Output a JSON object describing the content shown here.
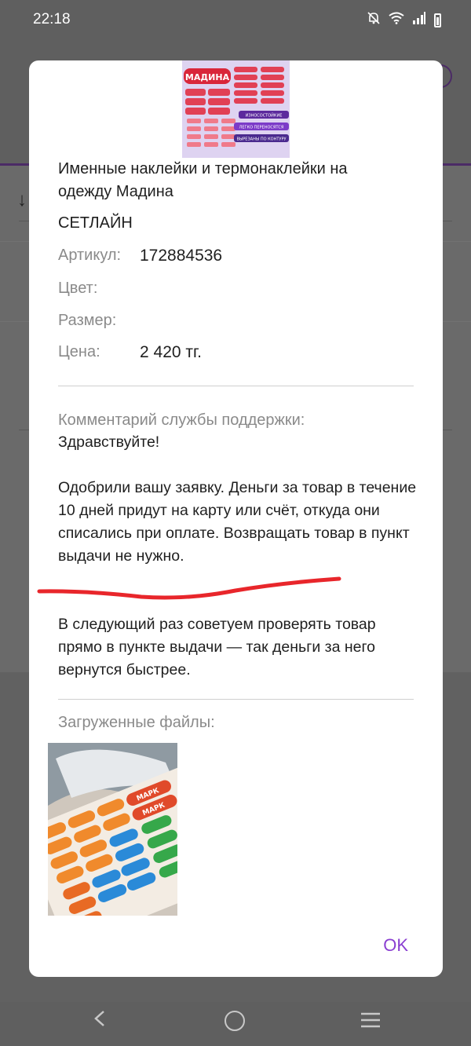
{
  "status_bar": {
    "time": "22:18"
  },
  "dialog": {
    "product": {
      "title": "Именные наклейки и термонаклейки на одежду Мадина",
      "brand": "СЕТЛАЙН",
      "article_label": "Артикул:",
      "article_value": "172884536",
      "color_label": "Цвет:",
      "color_value": "",
      "size_label": "Размер:",
      "size_value": "",
      "price_label": "Цена:",
      "price_value": "2 420 тг."
    },
    "product_image_text": {
      "banner": "МАДИНА",
      "badge1": "ИЗНОСОСТОЙКИЕ",
      "badge2": "ЛЕГКО ПЕРЕНОСЯТСЯ",
      "badge3": "ВЫРЕЗАНЫ ПО КОНТУРУ"
    },
    "support": {
      "label": "Комментарий службы поддержки:",
      "greeting": "Здравствуйте!",
      "paragraph1": "Одобрили вашу заявку. Деньги за товар в течение 10 дней придут на карту или счёт, откуда они списались при оплате. Возвращать товар в пункт выдачи не нужно.",
      "paragraph2": "В следующий раз советуем проверять товар прямо в пункте выдачи — так деньги за него вернутся быстрее."
    },
    "uploads": {
      "label": "Загруженные файлы:",
      "sticker_text": "МАРК"
    },
    "ok_label": "OK"
  },
  "colors": {
    "accent": "#8a3fd1",
    "annotation_red": "#e8262b",
    "overlay": "#5f5f5f"
  }
}
